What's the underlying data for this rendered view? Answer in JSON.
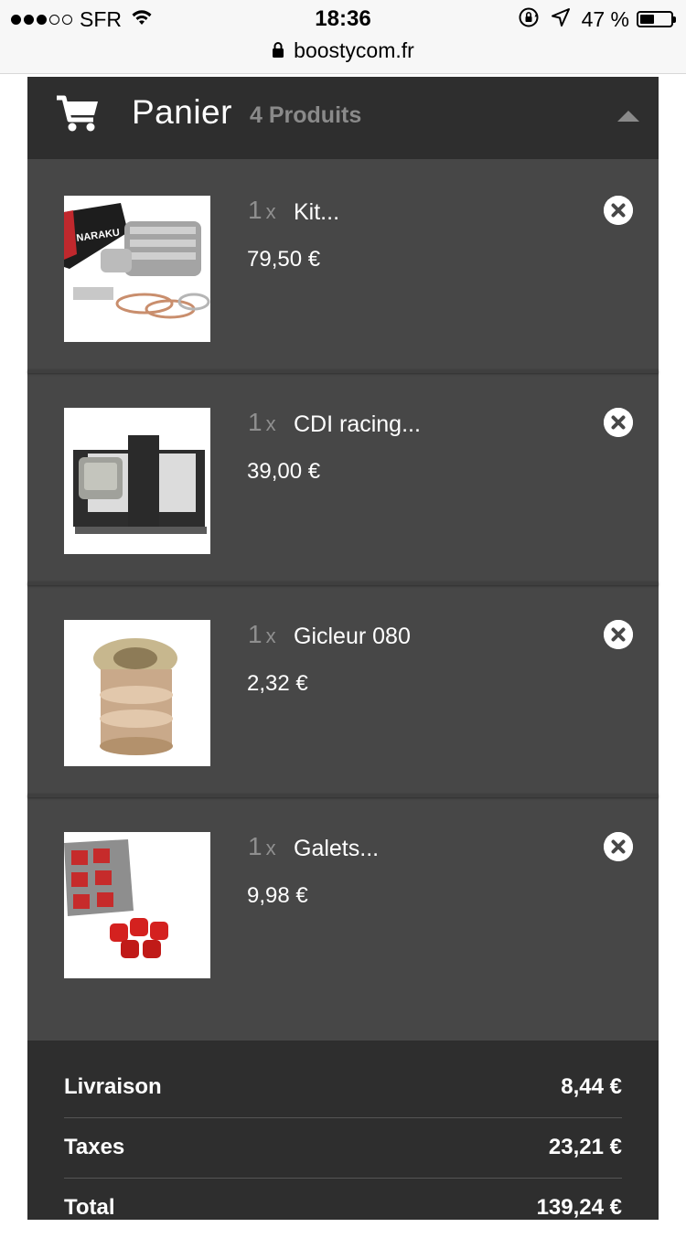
{
  "status": {
    "carrier": "SFR",
    "time": "18:36",
    "battery_pct": "47 %",
    "battery_level": 0.47,
    "signal_bars": 3,
    "url": "boostycom.fr"
  },
  "cart": {
    "title": "Panier",
    "count": "4 Produits",
    "items": [
      {
        "qty": "1",
        "x": "x",
        "name": "Kit...",
        "price": "79,50 €"
      },
      {
        "qty": "1",
        "x": "x",
        "name": "CDI racing...",
        "price": "39,00 €"
      },
      {
        "qty": "1",
        "x": "x",
        "name": "Gicleur 080",
        "price": "2,32 €"
      },
      {
        "qty": "1",
        "x": "x",
        "name": "Galets...",
        "price": "9,98 €"
      }
    ],
    "thumb_text": {
      "brand": "NARAKU"
    }
  },
  "totals": {
    "shipping_label": "Livraison",
    "shipping": "8,44 €",
    "tax_label": "Taxes",
    "tax": "23,21 €",
    "total_label": "Total",
    "total": "139,24 €"
  },
  "colors": {
    "header": "#2e2e2e",
    "items_bg": "#474747",
    "muted": "#8a8a8a"
  },
  "icons": [
    "signal-dots",
    "wifi-icon",
    "orientation-lock-icon",
    "location-arrow-icon",
    "battery-icon",
    "lock-icon",
    "cart-icon",
    "caret-up-icon",
    "remove-icon"
  ]
}
